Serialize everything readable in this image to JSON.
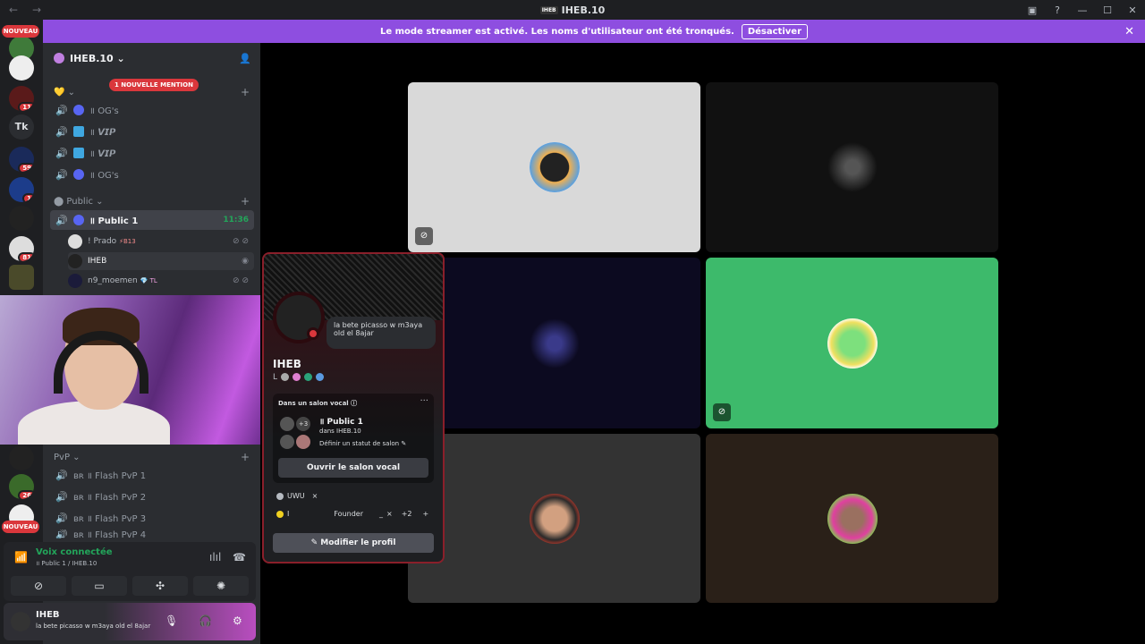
{
  "window": {
    "title": "IHEB.10",
    "logo_text": "IHEB",
    "back_icon": "←",
    "forward_icon": "→"
  },
  "banner": {
    "text": "Le mode streamer est activé. Les noms d'utilisateur ont été tronqués.",
    "button": "Désactiver"
  },
  "servers": {
    "nouveau_top": "NOUVEAU",
    "nouveau_bottom": "NOUVEAU",
    "tk_label": "Tk",
    "badges": [
      "11",
      "59",
      "1",
      "81",
      "26"
    ]
  },
  "guild": {
    "name": "IHEB.10 ⌄"
  },
  "mention": "1 NOUVELLE MENTION",
  "categories": [
    {
      "label": "💛 ⌄"
    },
    {
      "label": "⬤ Public ⌄"
    },
    {
      "label": "PvP ⌄"
    }
  ],
  "channels_top": [
    {
      "label": "OG's",
      "prefix": "॥"
    },
    {
      "label": "𝙑𝙄𝙋",
      "prefix": "॥"
    },
    {
      "label": "𝙑𝙄𝙋",
      "prefix": "॥"
    },
    {
      "label": "OG's",
      "prefix": "॥"
    }
  ],
  "active_channel": {
    "label": "॥ Public 1",
    "time": "11:36"
  },
  "voice_users": [
    {
      "name": "! Prado",
      "tag": "⚡B13"
    },
    {
      "name": "IHEB",
      "tag": ""
    },
    {
      "name": "n9_moemen",
      "tag": "💎 TL"
    }
  ],
  "pvp_channels": [
    {
      "label": "ʙʀ ॥ Flash PvP 1"
    },
    {
      "label": "ʙʀ ॥ Flash PvP 2"
    },
    {
      "label": "ʙʀ ॥ Flash PvP 3"
    },
    {
      "label": "ʙʀ ॥ Flash PvP 4"
    }
  ],
  "voice_panel": {
    "title": "Voix connectée",
    "subtitle": "॥ Public 1 / IHEB.10"
  },
  "user_panel": {
    "name": "IHEB",
    "status": "la bete picasso w m3aya old el 8ajar"
  },
  "popout": {
    "bubble": "la bete picasso w m3aya old el 8ajar",
    "name": "IHEB",
    "tag": "L",
    "voice_label": "Dans un salon vocal ⓘ",
    "more": "···",
    "count": "+3",
    "channel": "॥ Public 1",
    "server": "dans IHEB.10",
    "status_hint": "Définir un statut de salon ✎",
    "open_button": "Ouvrir le salon vocal",
    "role1": "UWU",
    "role_close": "×",
    "role2_prefix": "ⵏ",
    "role2": "Founder",
    "role_dash": "_",
    "role_more": "+2",
    "role_add": "+",
    "edit_button": "✎ Modifier le profil"
  },
  "colors": {
    "accent": "#8e4ee0",
    "green": "#23a55a",
    "red": "#da373c",
    "tile_speaking": "#3dba6b"
  }
}
